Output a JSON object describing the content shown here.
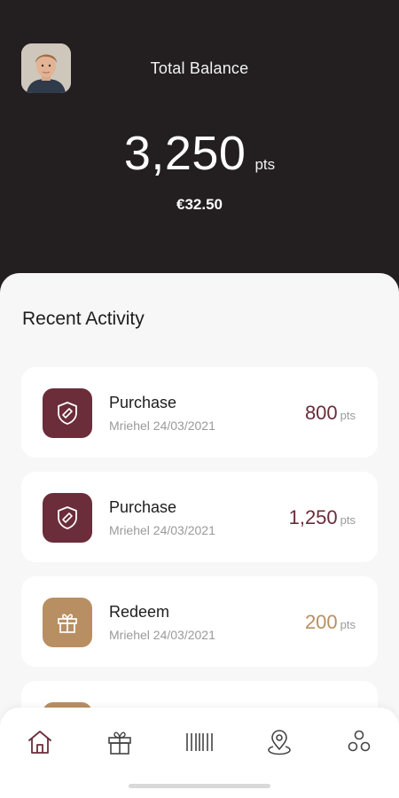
{
  "header": {
    "balance_label": "Total Balance",
    "points_value": "3,250",
    "points_unit": "pts",
    "euro_value": "€32.50"
  },
  "activity": {
    "title": "Recent Activity",
    "items": [
      {
        "type": "Purchase",
        "detail": "Mriehel 24/03/2021",
        "points": "800",
        "unit": "pts",
        "icon": "shield-badge-icon",
        "color": "#6b2d3a"
      },
      {
        "type": "Purchase",
        "detail": "Mriehel 24/03/2021",
        "points": "1,250",
        "unit": "pts",
        "icon": "shield-badge-icon",
        "color": "#6b2d3a"
      },
      {
        "type": "Redeem",
        "detail": "Mriehel 24/03/2021",
        "points": "200",
        "unit": "pts",
        "icon": "gift-icon",
        "color": "#b88f63"
      }
    ]
  },
  "nav": {
    "items": [
      {
        "icon": "home-icon",
        "active": true
      },
      {
        "icon": "gift-icon",
        "active": false
      },
      {
        "icon": "barcode-icon",
        "active": false
      },
      {
        "icon": "location-pin-icon",
        "active": false
      },
      {
        "icon": "more-options-icon",
        "active": false
      }
    ]
  },
  "colors": {
    "header_bg": "#231f20",
    "purchase": "#6b2d3a",
    "redeem": "#b88f63"
  }
}
